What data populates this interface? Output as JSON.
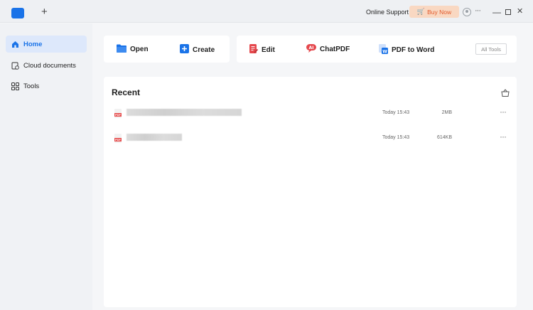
{
  "titlebar": {
    "new_tab": "+",
    "online_support": "Online Support",
    "buy_now": "Buy Now",
    "more": "···",
    "minimize": "—",
    "close": "✕"
  },
  "sidebar": {
    "items": [
      {
        "label": "Home",
        "icon": "home-icon",
        "active": true
      },
      {
        "label": "Cloud documents",
        "icon": "cloud-doc-icon",
        "active": false
      },
      {
        "label": "Tools",
        "icon": "tools-grid-icon",
        "active": false
      }
    ]
  },
  "tools": {
    "open": "Open",
    "create": "Create",
    "edit": "Edit",
    "chatpdf": "ChatPDF",
    "pdf_to_word": "PDF to Word",
    "all_tools": "All Tools"
  },
  "recent": {
    "title": "Recent",
    "rows": [
      {
        "time": "Today 15:43",
        "size": "2MB",
        "more": "···"
      },
      {
        "time": "Today 15:43",
        "size": "614KB",
        "more": "···"
      }
    ]
  },
  "colors": {
    "accent": "#1a73e8",
    "buy_bg": "#f9d8c2",
    "buy_text": "#e15a2c",
    "edit_red": "#e5484d"
  }
}
